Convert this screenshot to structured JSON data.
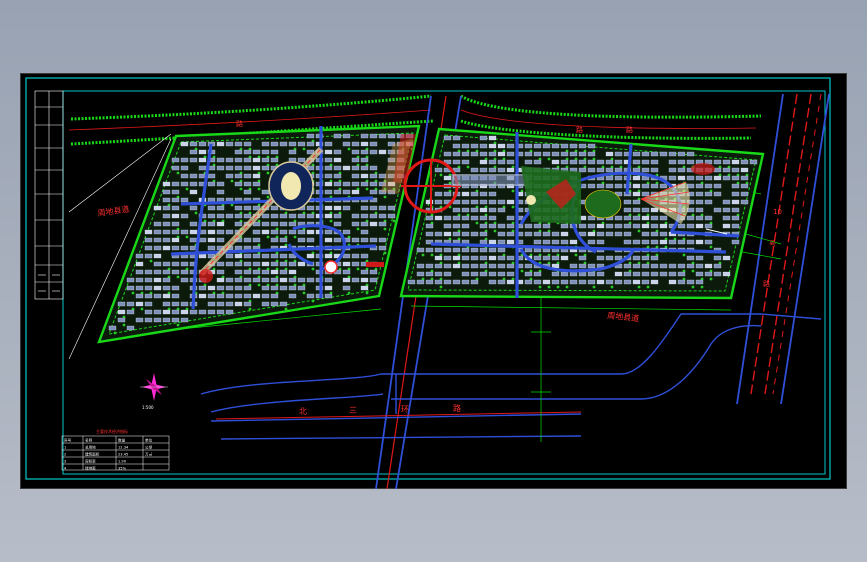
{
  "drawing": {
    "colors": {
      "background": "#000000",
      "frame": "#00c8c8",
      "green_boundary": "#18d818",
      "road_blue": "#2f4fd8",
      "road_red": "#e01818",
      "building_fill": "#7d8fb8",
      "plaza_red": "#d01818",
      "label_red": "#ff3030",
      "leader_green": "#00e000"
    },
    "labels": {
      "west_road": "周地县道",
      "east_road": "周地县道",
      "north_third_ring_1": "北",
      "north_third_ring_2": "三",
      "north_third_ring_3": "环",
      "north_third_ring_4": "路",
      "north_road_1": "路",
      "north_road_2": "路",
      "north_road_3": "路",
      "east_main_road_1": "10",
      "east_main_road_2": "号",
      "east_main_road_3": "路",
      "compass": "1:500"
    },
    "table": {
      "title": "主要技术经济指标",
      "header": [
        "序号",
        "名称",
        "数量",
        "单位"
      ],
      "rows": [
        [
          "1",
          "总用地",
          "12.34",
          "公顷"
        ],
        [
          "2",
          "建筑面积",
          "23.45",
          "万㎡"
        ],
        [
          "3",
          "容积率",
          "1.90",
          ""
        ],
        [
          "4",
          "绿地率",
          "35%",
          ""
        ]
      ]
    }
  }
}
